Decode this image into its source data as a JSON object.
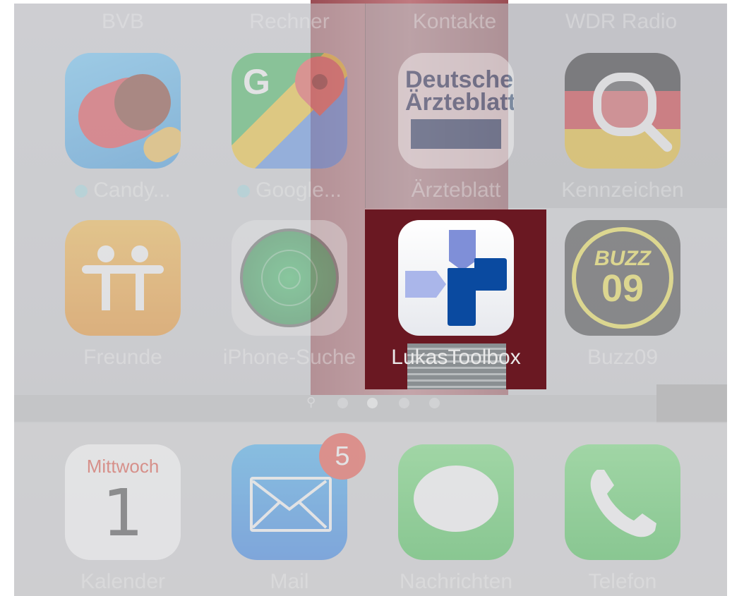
{
  "top_row_labels": [
    "BVB",
    "Rechner",
    "Kontakte",
    "WDR Radio"
  ],
  "grid": {
    "row1": [
      {
        "label": "Candy...",
        "icon": "candy-crush-icon",
        "new_dot": true
      },
      {
        "label": "Google...",
        "icon": "google-maps-icon",
        "new_dot": true
      },
      {
        "label": "Ärzteblatt",
        "icon": "aerzteblatt-icon",
        "icon_text_1": "Deutsches",
        "icon_text_2": "Ärzteblatt"
      },
      {
        "label": "Kennzeichen",
        "icon": "kennzeichen-magnifier-icon"
      }
    ],
    "row2": [
      {
        "label": "Freunde",
        "icon": "find-friends-icon"
      },
      {
        "label": "iPhone-Suche",
        "icon": "find-iphone-radar-icon"
      },
      {
        "label": "LukasToolbox",
        "icon": "lukas-toolbox-icon",
        "highlighted": true
      },
      {
        "label": "Buzz09",
        "icon": "buzz09-icon",
        "icon_text_1": "BUZZ",
        "icon_text_2": "09"
      }
    ]
  },
  "page_dots": {
    "search_glyph": "⚲",
    "count": 4,
    "active_index": 1
  },
  "dock": [
    {
      "label": "Kalender",
      "icon": "calendar-icon",
      "weekday": "Mittwoch",
      "day": "1"
    },
    {
      "label": "Mail",
      "icon": "mail-envelope-icon",
      "badge": "5"
    },
    {
      "label": "Nachrichten",
      "icon": "messages-bubble-icon"
    },
    {
      "label": "Telefon",
      "icon": "phone-handset-icon"
    }
  ],
  "colors": {
    "badge": "#ec3b2e",
    "highlight_bg": "#6a1822",
    "toolbox_blue": "#0a4aa0",
    "toolbox_light": "#7f8fd8"
  }
}
